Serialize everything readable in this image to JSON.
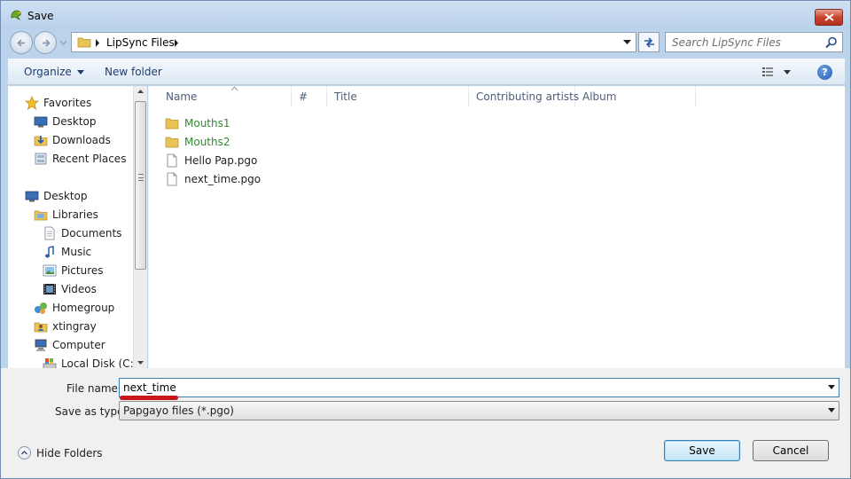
{
  "window": {
    "title": "Save"
  },
  "address": {
    "segment": "LipSync Files",
    "search_placeholder": "Search LipSync Files"
  },
  "toolbar": {
    "organize": "Organize",
    "new_folder": "New folder"
  },
  "nav": {
    "items": [
      {
        "label": "Favorites",
        "icon": "star-icon"
      },
      {
        "label": "Desktop",
        "icon": "desktop-icon"
      },
      {
        "label": "Downloads",
        "icon": "downloads-icon"
      },
      {
        "label": "Recent Places",
        "icon": "recent-places-icon"
      },
      {
        "label": "Desktop",
        "icon": "desktop-icon"
      },
      {
        "label": "Libraries",
        "icon": "libraries-icon"
      },
      {
        "label": "Documents",
        "icon": "documents-icon"
      },
      {
        "label": "Music",
        "icon": "music-icon"
      },
      {
        "label": "Pictures",
        "icon": "pictures-icon"
      },
      {
        "label": "Videos",
        "icon": "videos-icon"
      },
      {
        "label": "Homegroup",
        "icon": "homegroup-icon"
      },
      {
        "label": "xtingray",
        "icon": "user-folder-icon"
      },
      {
        "label": "Computer",
        "icon": "computer-icon"
      },
      {
        "label": "Local Disk (C:)",
        "icon": "local-disk-icon"
      }
    ]
  },
  "columns": [
    "Name",
    "#",
    "Title",
    "Contributing artists",
    "Album"
  ],
  "files": [
    {
      "name": "Mouths1",
      "type": "folder"
    },
    {
      "name": "Mouths2",
      "type": "folder"
    },
    {
      "name": "Hello Pap.pgo",
      "type": "file"
    },
    {
      "name": "next_time.pgo",
      "type": "file"
    }
  ],
  "form": {
    "file_name_label": "File name:",
    "file_name_value": "next_time",
    "save_type_label": "Save as type:",
    "save_type_value": "Papgayo files (*.pgo)"
  },
  "footer": {
    "hide_folders": "Hide Folders",
    "save": "Save",
    "cancel": "Cancel"
  },
  "colors": {
    "folder_text": "#2f8a2f",
    "annotation_mark": "#c8171c",
    "accent": "#3c7fb1"
  }
}
